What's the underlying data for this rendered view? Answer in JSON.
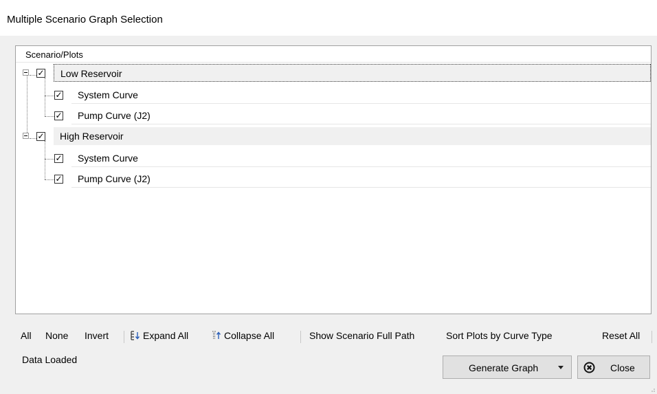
{
  "window": {
    "title": "Multiple Scenario Graph Selection"
  },
  "tree": {
    "column_header": "Scenario/Plots",
    "scenarios": [
      {
        "label": "Low Reservoir",
        "checked": true,
        "expanded": true,
        "children": [
          {
            "label": "System Curve",
            "checked": true
          },
          {
            "label": "Pump Curve (J2)",
            "checked": true
          }
        ]
      },
      {
        "label": "High Reservoir",
        "checked": true,
        "expanded": true,
        "children": [
          {
            "label": "System Curve",
            "checked": true
          },
          {
            "label": "Pump Curve (J2)",
            "checked": true
          }
        ]
      }
    ]
  },
  "toolbar": {
    "all": "All",
    "none": "None",
    "invert": "Invert",
    "expand_all": "Expand All",
    "collapse_all": "Collapse All",
    "show_full_path": "Show Scenario Full Path",
    "sort_by_curve": "Sort Plots by Curve Type",
    "reset_all": "Reset All"
  },
  "status": {
    "text": "Data Loaded"
  },
  "buttons": {
    "generate": "Generate Graph",
    "close": "Close"
  },
  "icons": {
    "expand": "expand-all-icon",
    "collapse": "collapse-all-icon",
    "dropdown": "chevron-down-icon",
    "close": "close-circle-icon"
  }
}
